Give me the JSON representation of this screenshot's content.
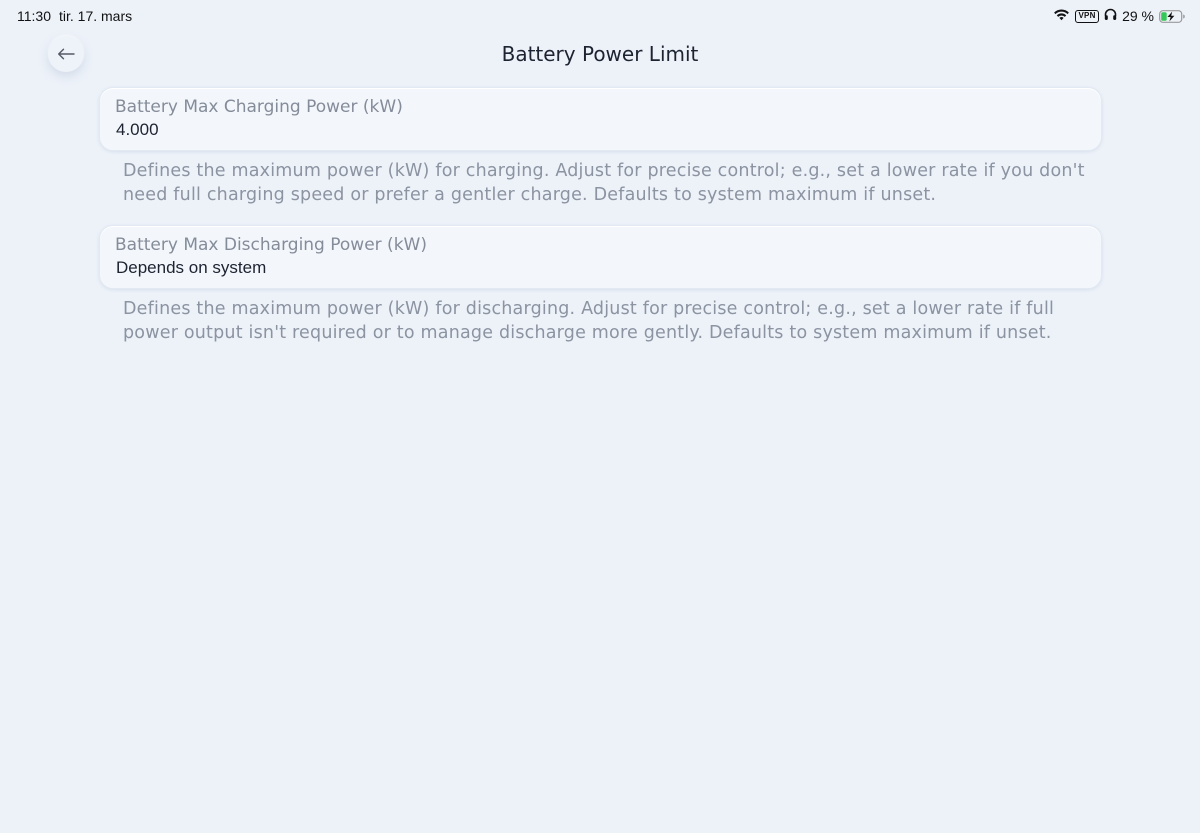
{
  "status_bar": {
    "time": "11:30",
    "date": "tir. 17. mars",
    "vpn": "VPN",
    "battery_percent": "29 %",
    "battery_level": 0.29,
    "charging": true,
    "icons": [
      "wifi-icon",
      "vpn-badge",
      "headphones-icon",
      "battery-charging-icon"
    ]
  },
  "header": {
    "title": "Battery Power Limit",
    "back_icon": "arrow-left-icon"
  },
  "fields": [
    {
      "label": "Battery Max Charging Power (kW)",
      "value": "4.000",
      "helper": "Defines the maximum power (kW) for charging. Adjust for precise control; e.g., set a lower rate if you don't need full charging speed or prefer a gentler charge. Defaults to system maximum if unset."
    },
    {
      "label": "Battery Max Discharging Power (kW)",
      "value": "Depends on system",
      "helper": "Defines the maximum power (kW) for discharging. Adjust for precise control; e.g., set a lower rate if full power output isn't required or to manage discharge more gently. Defaults to system maximum if unset."
    }
  ],
  "colors": {
    "background": "#edf2f9",
    "field_background": "#f3f7fc",
    "label": "#858c99",
    "helper": "#8c93a1",
    "text": "#1d2330",
    "battery_charging": "#34c759"
  }
}
